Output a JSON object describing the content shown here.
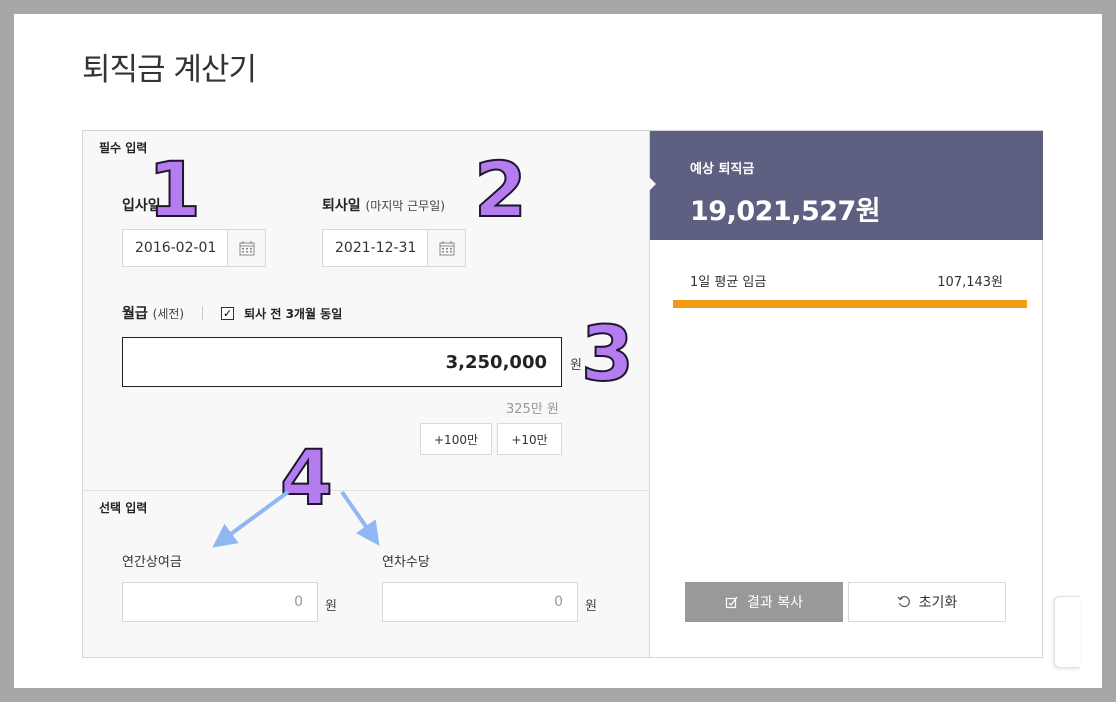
{
  "page_title": "퇴직금 계산기",
  "required_section": {
    "label": "필수 입력"
  },
  "join_date": {
    "label": "입사일",
    "value": "2016-02-01",
    "icon": "calendar-icon"
  },
  "leave_date": {
    "label": "퇴사일",
    "sub_label": "(마지막 근무일)",
    "value": "2021-12-31",
    "icon": "calendar-icon"
  },
  "salary": {
    "label": "월급",
    "sub_label": "(세전)",
    "checkbox_label": "퇴사 전 3개월 동일",
    "checkbox_checked": true,
    "value": "3,250,000",
    "unit": "원",
    "hint": "325만 원",
    "add_buttons": [
      "+100만",
      "+10만"
    ]
  },
  "optional_section": {
    "label": "선택 입력"
  },
  "bonus": {
    "label": "연간상여금",
    "value": "0",
    "unit": "원"
  },
  "annual_leave_pay": {
    "label": "연차수당",
    "value": "0",
    "unit": "원"
  },
  "result": {
    "label": "예상 퇴직금",
    "value": "19,021,527원",
    "avg_label": "1일 평균 임금",
    "avg_value": "107,143원",
    "avg_bar_fill": 1.0
  },
  "buttons": {
    "copy": "결과 복사",
    "reset": "초기화"
  },
  "annotations": [
    "1",
    "2",
    "3",
    "4"
  ],
  "colors": {
    "result_header": "#5e6081",
    "progress": "#f39c12",
    "copy_button": "#999999",
    "annotation": "#b57cf0"
  }
}
